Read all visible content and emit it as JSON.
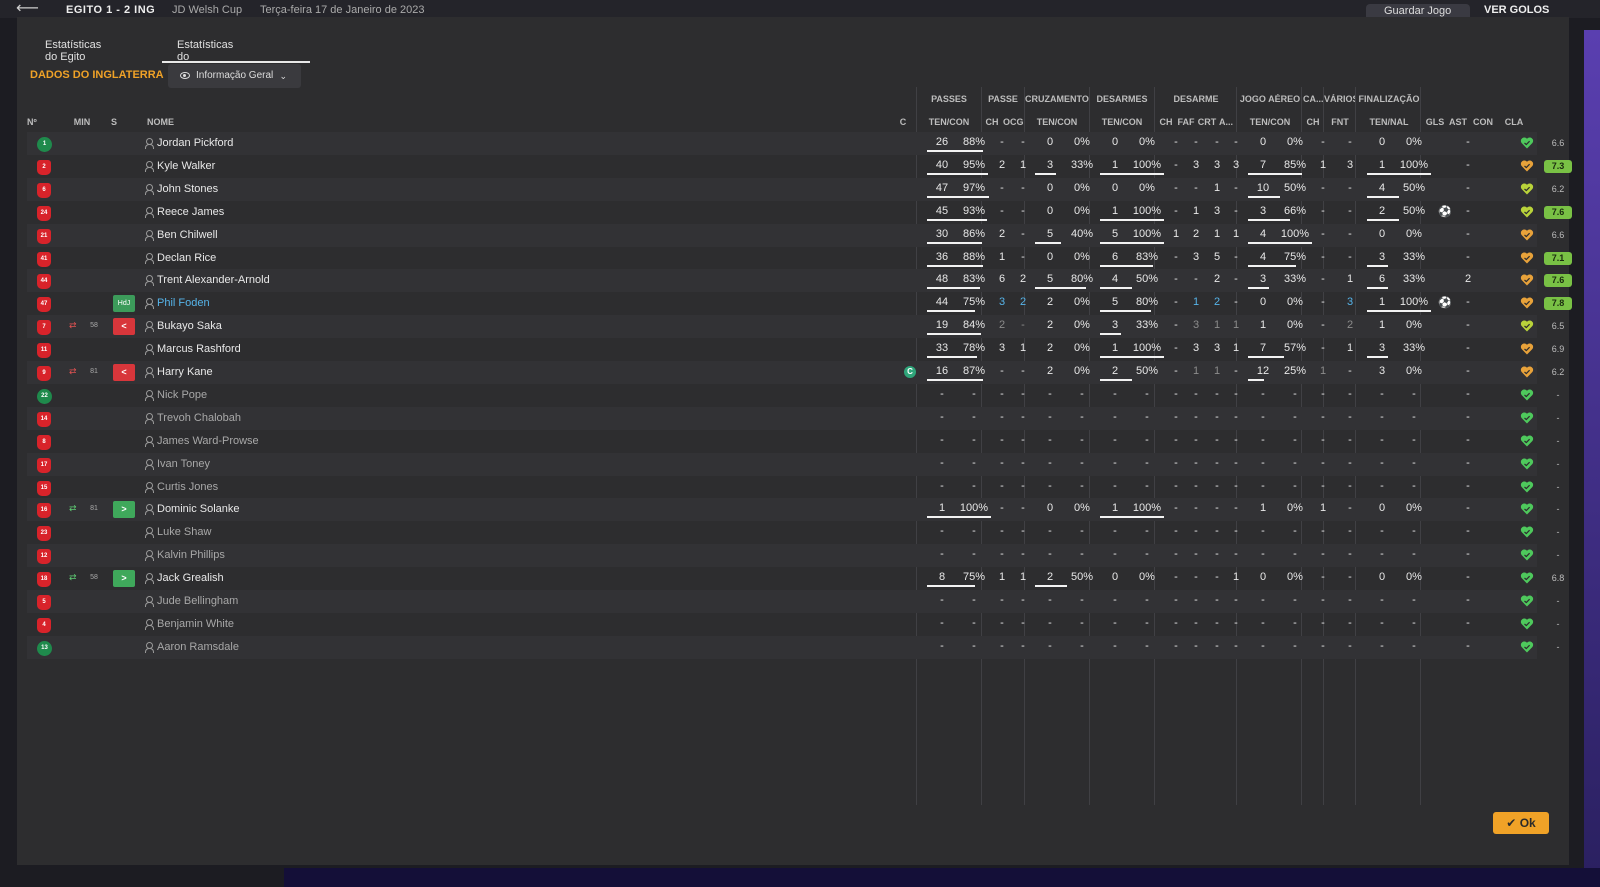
{
  "background": {
    "score": "EGITO 1 - 2 ING",
    "competition": "JD Welsh Cup",
    "date": "Terça-feira 17 de Janeiro de 2023",
    "save_label": "Guardar Jogo",
    "goals_label": "VER GOLOS"
  },
  "tabs": [
    {
      "label": "Estatísticas do Egito",
      "active": false
    },
    {
      "label": "Estatísticas do Inglaterra",
      "active": true
    }
  ],
  "section_title": "DADOS DO INGLATERRA",
  "view_dropdown": {
    "selected": "Informação Geral"
  },
  "groups": [
    "PASSES",
    "PASSE",
    "CRUZAMENTOS",
    "DESARMES",
    "DESARME",
    "JOGO AÉREO",
    "CA...",
    "VÁRIOS",
    "FINALIZAÇÃO"
  ],
  "columns": {
    "num": "Nº",
    "min": "MIN",
    "s": "S",
    "name": "NOME",
    "c": "C",
    "passes": "TEN/CON",
    "passe_ch": "CH",
    "passe_ocg": "OCG",
    "cruz": "TEN/CON",
    "desarmes": "TEN/CON",
    "des_ch": "CH",
    "des_faf": "FAF",
    "des_crt": "CRT",
    "des_a": "A...",
    "aereo": "TEN/CON",
    "ca_ch": "CH",
    "var_fnt": "FNT",
    "fin": "TEN/NAL",
    "gls": "GLS",
    "ast": "AST",
    "con": "CON",
    "cla": "CLA"
  },
  "colors": {
    "accent": "#f0a227",
    "highlight_player": "#56b4e9",
    "rating_good": "#79c145",
    "sub_off": "#d8363b",
    "sub_on": "#3fa85b"
  },
  "players": [
    {
      "num": "1",
      "kit": "gk",
      "name": "Jordan Pickford",
      "style": "",
      "sub": "",
      "min": "",
      "s": "",
      "cap": false,
      "passes": [
        "26",
        "88%"
      ],
      "passes_bar": 88,
      "pch": "-",
      "pocg": "-",
      "cruz": [
        "0",
        "0%"
      ],
      "cruz_bar": 0,
      "des": [
        "0",
        "0%"
      ],
      "des_bar": 0,
      "dch": "-",
      "faf": "-",
      "crt": "-",
      "da": "-",
      "aer": [
        "0",
        "0%"
      ],
      "aer_bar": 0,
      "cach": "-",
      "fnt": "-",
      "fin": [
        "0",
        "0%"
      ],
      "fin_bar": 0,
      "gls": "",
      "ast": "-",
      "con": "#4ec95c",
      "cla": "6.6",
      "cla_good": false
    },
    {
      "num": "2",
      "kit": "out",
      "name": "Kyle Walker",
      "style": "",
      "sub": "",
      "min": "",
      "s": "",
      "cap": false,
      "passes": [
        "40",
        "95%"
      ],
      "passes_bar": 95,
      "pch": "2",
      "pocg": "1",
      "cruz": [
        "3",
        "33%"
      ],
      "cruz_bar": 33,
      "des": [
        "1",
        "100%"
      ],
      "des_bar": 100,
      "dch": "-",
      "faf": "3",
      "crt": "3",
      "da": "3",
      "aer": [
        "7",
        "85%"
      ],
      "aer_bar": 85,
      "cach": "1",
      "fnt": "3",
      "fin": [
        "1",
        "100%"
      ],
      "fin_bar": 100,
      "gls": "",
      "ast": "-",
      "con": "#e8a23a",
      "cla": "7.3",
      "cla_good": true
    },
    {
      "num": "6",
      "kit": "out",
      "name": "John Stones",
      "style": "",
      "sub": "",
      "min": "",
      "s": "",
      "cap": false,
      "passes": [
        "47",
        "97%"
      ],
      "passes_bar": 97,
      "pch": "-",
      "pocg": "-",
      "cruz": [
        "0",
        "0%"
      ],
      "cruz_bar": 0,
      "des": [
        "0",
        "0%"
      ],
      "des_bar": 0,
      "dch": "-",
      "faf": "-",
      "crt": "1",
      "da": "-",
      "aer": [
        "10",
        "50%"
      ],
      "aer_bar": 50,
      "cach": "-",
      "fnt": "-",
      "fin": [
        "4",
        "50%"
      ],
      "fin_bar": 50,
      "gls": "",
      "ast": "-",
      "con": "#b9d33a",
      "cla": "6.2",
      "cla_good": false
    },
    {
      "num": "24",
      "kit": "out",
      "name": "Reece James",
      "style": "",
      "sub": "",
      "min": "",
      "s": "",
      "cap": false,
      "passes": [
        "45",
        "93%"
      ],
      "passes_bar": 93,
      "pch": "-",
      "pocg": "-",
      "cruz": [
        "0",
        "0%"
      ],
      "cruz_bar": 0,
      "des": [
        "1",
        "100%"
      ],
      "des_bar": 100,
      "dch": "-",
      "faf": "1",
      "crt": "3",
      "da": "-",
      "aer": [
        "3",
        "66%"
      ],
      "aer_bar": 66,
      "cach": "-",
      "fnt": "-",
      "fin": [
        "2",
        "50%"
      ],
      "fin_bar": 50,
      "gls": "⚽",
      "ast": "-",
      "con": "#b9d33a",
      "cla": "7.6",
      "cla_good": true
    },
    {
      "num": "21",
      "kit": "out",
      "name": "Ben Chilwell",
      "style": "",
      "sub": "",
      "min": "",
      "s": "",
      "cap": false,
      "passes": [
        "30",
        "86%"
      ],
      "passes_bar": 86,
      "pch": "2",
      "pocg": "-",
      "cruz": [
        "5",
        "40%"
      ],
      "cruz_bar": 40,
      "des": [
        "5",
        "100%"
      ],
      "des_bar": 100,
      "dch": "1",
      "faf": "2",
      "crt": "1",
      "da": "1",
      "aer": [
        "4",
        "100%"
      ],
      "aer_bar": 100,
      "cach": "-",
      "fnt": "-",
      "fin": [
        "0",
        "0%"
      ],
      "fin_bar": 0,
      "gls": "",
      "ast": "-",
      "con": "#e8a23a",
      "cla": "6.6",
      "cla_good": false
    },
    {
      "num": "41",
      "kit": "out",
      "name": "Declan Rice",
      "style": "",
      "sub": "",
      "min": "",
      "s": "",
      "cap": false,
      "passes": [
        "36",
        "88%"
      ],
      "passes_bar": 88,
      "pch": "1",
      "pocg": "-",
      "cruz": [
        "0",
        "0%"
      ],
      "cruz_bar": 0,
      "des": [
        "6",
        "83%"
      ],
      "des_bar": 83,
      "dch": "-",
      "faf": "3",
      "crt": "5",
      "da": "-",
      "aer": [
        "4",
        "75%"
      ],
      "aer_bar": 75,
      "cach": "-",
      "fnt": "-",
      "fin": [
        "3",
        "33%"
      ],
      "fin_bar": 33,
      "gls": "",
      "ast": "-",
      "con": "#e8a23a",
      "cla": "7.1",
      "cla_good": true
    },
    {
      "num": "44",
      "kit": "out",
      "name": "Trent Alexander-Arnold",
      "style": "",
      "sub": "",
      "min": "",
      "s": "",
      "cap": false,
      "passes": [
        "48",
        "83%"
      ],
      "passes_bar": 83,
      "pch": "6",
      "pocg": "2",
      "cruz": [
        "5",
        "80%"
      ],
      "cruz_bar": 80,
      "des": [
        "4",
        "50%"
      ],
      "des_bar": 50,
      "dch": "-",
      "faf": "-",
      "crt": "2",
      "da": "-",
      "aer": [
        "3",
        "33%"
      ],
      "aer_bar": 33,
      "cach": "-",
      "fnt": "1",
      "fin": [
        "6",
        "33%"
      ],
      "fin_bar": 33,
      "gls": "",
      "ast": "2",
      "con": "#e8a23a",
      "cla": "7.6",
      "cla_good": true
    },
    {
      "num": "47",
      "kit": "out",
      "name": "Phil Foden",
      "style": "hl",
      "sub": "",
      "min": "",
      "s": "HdJ",
      "cap": false,
      "passes": [
        "44",
        "75%"
      ],
      "passes_bar": 75,
      "pch": "3",
      "pocg": "2",
      "cruz": [
        "2",
        "0%"
      ],
      "cruz_bar": 0,
      "des": [
        "5",
        "80%"
      ],
      "des_bar": 80,
      "dch": "-",
      "faf": "1",
      "crt": "2",
      "da": "-",
      "aer": [
        "0",
        "0%"
      ],
      "aer_bar": 0,
      "cach": "-",
      "fnt": "3",
      "fin": [
        "1",
        "100%"
      ],
      "fin_bar": 100,
      "gls": "⚽",
      "ast": "-",
      "con": "#e8a23a",
      "cla": "7.8",
      "cla_good": true
    },
    {
      "num": "7",
      "kit": "out",
      "name": "Bukayo Saka",
      "style": "",
      "sub": "off",
      "min": "58",
      "s": "<",
      "cap": false,
      "passes": [
        "19",
        "84%"
      ],
      "passes_bar": 84,
      "pch": "2",
      "pocg": "-",
      "cruz": [
        "2",
        "0%"
      ],
      "cruz_bar": 0,
      "des": [
        "3",
        "33%"
      ],
      "des_bar": 33,
      "dch": "-",
      "faf": "3",
      "crt": "1",
      "da": "1",
      "aer": [
        "1",
        "0%"
      ],
      "aer_bar": 0,
      "cach": "-",
      "fnt": "2",
      "fin": [
        "1",
        "0%"
      ],
      "fin_bar": 0,
      "gls": "",
      "ast": "-",
      "con": "#b9d33a",
      "cla": "6.5",
      "cla_good": false
    },
    {
      "num": "11",
      "kit": "out",
      "name": "Marcus Rashford",
      "style": "",
      "sub": "",
      "min": "",
      "s": "",
      "cap": false,
      "passes": [
        "33",
        "78%"
      ],
      "passes_bar": 78,
      "pch": "3",
      "pocg": "1",
      "cruz": [
        "2",
        "0%"
      ],
      "cruz_bar": 0,
      "des": [
        "1",
        "100%"
      ],
      "des_bar": 100,
      "dch": "-",
      "faf": "3",
      "crt": "3",
      "da": "1",
      "aer": [
        "7",
        "57%"
      ],
      "aer_bar": 57,
      "cach": "-",
      "fnt": "1",
      "fin": [
        "3",
        "33%"
      ],
      "fin_bar": 33,
      "gls": "",
      "ast": "-",
      "con": "#e8a23a",
      "cla": "6.9",
      "cla_good": false
    },
    {
      "num": "9",
      "kit": "out",
      "name": "Harry Kane",
      "style": "",
      "sub": "off",
      "min": "81",
      "s": "<",
      "cap": true,
      "passes": [
        "16",
        "87%"
      ],
      "passes_bar": 87,
      "pch": "-",
      "pocg": "-",
      "cruz": [
        "2",
        "0%"
      ],
      "cruz_bar": 0,
      "des": [
        "2",
        "50%"
      ],
      "des_bar": 50,
      "dch": "-",
      "faf": "1",
      "crt": "1",
      "da": "-",
      "aer": [
        "12",
        "25%"
      ],
      "aer_bar": 25,
      "cach": "1",
      "fnt": "-",
      "fin": [
        "3",
        "0%"
      ],
      "fin_bar": 0,
      "gls": "",
      "ast": "-",
      "con": "#e8a23a",
      "cla": "6.2",
      "cla_good": false
    },
    {
      "num": "22",
      "kit": "gk",
      "name": "Nick Pope",
      "style": "sub2",
      "sub": "",
      "min": "",
      "s": "",
      "cap": false,
      "empty": true,
      "con": "#4ec95c",
      "cla": "-"
    },
    {
      "num": "14",
      "kit": "out",
      "name": "Trevoh Chalobah",
      "style": "sub2",
      "sub": "",
      "min": "",
      "s": "",
      "cap": false,
      "empty": true,
      "con": "#4ec95c",
      "cla": "-"
    },
    {
      "num": "8",
      "kit": "out",
      "name": "James Ward-Prowse",
      "style": "sub2",
      "sub": "",
      "min": "",
      "s": "",
      "cap": false,
      "empty": true,
      "con": "#4ec95c",
      "cla": "-"
    },
    {
      "num": "17",
      "kit": "out",
      "name": "Ivan Toney",
      "style": "sub2",
      "sub": "",
      "min": "",
      "s": "",
      "cap": false,
      "empty": true,
      "con": "#4ec95c",
      "cla": "-"
    },
    {
      "num": "15",
      "kit": "out",
      "name": "Curtis Jones",
      "style": "sub2",
      "sub": "",
      "min": "",
      "s": "",
      "cap": false,
      "empty": true,
      "con": "#4ec95c",
      "cla": "-"
    },
    {
      "num": "16",
      "kit": "out",
      "name": "Dominic Solanke",
      "style": "",
      "sub": "on",
      "min": "81",
      "s": ">",
      "cap": false,
      "passes": [
        "1",
        "100%"
      ],
      "passes_bar": 100,
      "pch": "-",
      "pocg": "-",
      "cruz": [
        "0",
        "0%"
      ],
      "cruz_bar": 0,
      "des": [
        "1",
        "100%"
      ],
      "des_bar": 100,
      "dch": "-",
      "faf": "-",
      "crt": "-",
      "da": "-",
      "aer": [
        "1",
        "0%"
      ],
      "aer_bar": 0,
      "cach": "1",
      "fnt": "-",
      "fin": [
        "0",
        "0%"
      ],
      "fin_bar": 0,
      "gls": "",
      "ast": "-",
      "con": "#4ec95c",
      "cla": "-",
      "cla_good": false
    },
    {
      "num": "23",
      "kit": "out",
      "name": "Luke Shaw",
      "style": "sub2",
      "sub": "",
      "min": "",
      "s": "",
      "cap": false,
      "empty": true,
      "con": "#4ec95c",
      "cla": "-"
    },
    {
      "num": "12",
      "kit": "out",
      "name": "Kalvin Phillips",
      "style": "sub2",
      "sub": "",
      "min": "",
      "s": "",
      "cap": false,
      "empty": true,
      "con": "#4ec95c",
      "cla": "-"
    },
    {
      "num": "18",
      "kit": "out",
      "name": "Jack Grealish",
      "style": "",
      "sub": "on",
      "min": "58",
      "s": ">",
      "cap": false,
      "passes": [
        "8",
        "75%"
      ],
      "passes_bar": 75,
      "pch": "1",
      "pocg": "1",
      "cruz": [
        "2",
        "50%"
      ],
      "cruz_bar": 50,
      "des": [
        "0",
        "0%"
      ],
      "des_bar": 0,
      "dch": "-",
      "faf": "-",
      "crt": "-",
      "da": "1",
      "aer": [
        "0",
        "0%"
      ],
      "aer_bar": 0,
      "cach": "-",
      "fnt": "-",
      "fin": [
        "0",
        "0%"
      ],
      "fin_bar": 0,
      "gls": "",
      "ast": "-",
      "con": "#4ec95c",
      "cla": "6.8",
      "cla_good": false
    },
    {
      "num": "5",
      "kit": "out",
      "name": "Jude Bellingham",
      "style": "sub2",
      "sub": "",
      "min": "",
      "s": "",
      "cap": false,
      "empty": true,
      "con": "#4ec95c",
      "cla": "-"
    },
    {
      "num": "4",
      "kit": "out",
      "name": "Benjamin White",
      "style": "sub2",
      "sub": "",
      "min": "",
      "s": "",
      "cap": false,
      "empty": true,
      "con": "#4ec95c",
      "cla": "-"
    },
    {
      "num": "13",
      "kit": "gk",
      "name": "Aaron Ramsdale",
      "style": "sub2",
      "sub": "",
      "min": "",
      "s": "",
      "cap": false,
      "empty": true,
      "con": "#4ec95c",
      "cla": "-"
    }
  ],
  "ok_label": "Ok"
}
